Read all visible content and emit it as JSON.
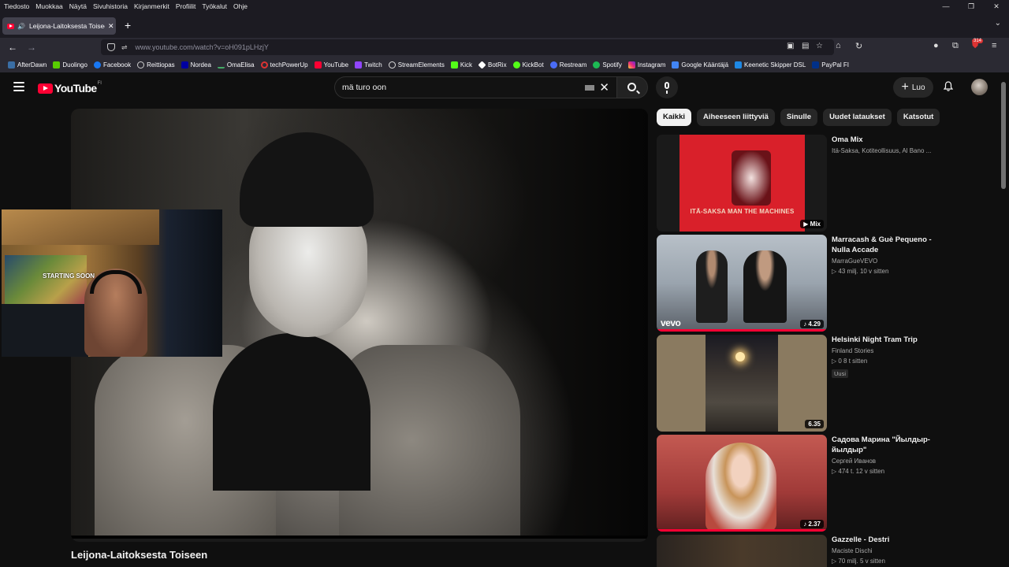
{
  "menubar": {
    "items": [
      "Tiedosto",
      "Muokkaa",
      "Näytä",
      "Sivuhistoria",
      "Kirjanmerkit",
      "Profiilit",
      "Työkalut",
      "Ohje"
    ]
  },
  "window_controls": {
    "minimize": "—",
    "restore": "❐",
    "close": "✕"
  },
  "tab": {
    "title": "Leijona-Laitoksesta Toiseen",
    "close": "✕"
  },
  "new_tab": "+",
  "tab_overflow": "⌄",
  "urlbar": {
    "url": "www.youtube.com/watch?v=oH091pLHzjY"
  },
  "extensions_badge": "314",
  "bookmarks": [
    {
      "label": "AfterDawn",
      "color": "#3a6ea5"
    },
    {
      "label": "Duolingo",
      "color": "#58cc02"
    },
    {
      "label": "Facebook",
      "color": "#1877f2"
    },
    {
      "label": "Reittiopas",
      "color": "#cccccc"
    },
    {
      "label": "Nordea",
      "color": "#0000a0"
    },
    {
      "label": "OmaElisa",
      "color": "#2b2a33"
    },
    {
      "label": "techPowerUp",
      "color": "#d33"
    },
    {
      "label": "YouTube",
      "color": "#ff0033"
    },
    {
      "label": "Twitch",
      "color": "#9146ff"
    },
    {
      "label": "StreamElements",
      "color": "#dddddd"
    },
    {
      "label": "Kick",
      "color": "#53fc18"
    },
    {
      "label": "BotRix",
      "color": "#ffffff"
    },
    {
      "label": "KickBot",
      "color": "#53fc18"
    },
    {
      "label": "Restream",
      "color": "#4a6cf7"
    },
    {
      "label": "Spotify",
      "color": "#1db954"
    },
    {
      "label": "Instagram",
      "color": "#d6249f"
    },
    {
      "label": "Google Kääntäjä",
      "color": "#4285f4"
    },
    {
      "label": "Keenetic Skipper DSL",
      "color": "#1e88e5"
    },
    {
      "label": "PayPal FI",
      "color": "#003087"
    }
  ],
  "youtube": {
    "logo_text": "YouTube",
    "region": "FI",
    "search_query": "mä turo oon",
    "clear_label": "✕",
    "create_label": "Luo",
    "create_plus": "+"
  },
  "webcam": {
    "poster_text": "STARTING SOON"
  },
  "video": {
    "title": "Leijona-Laitoksesta Toiseen"
  },
  "chips": [
    "Kaikki",
    "Aiheeseen liittyviä",
    "Sinulle",
    "Uudet lataukset",
    "Katsotut"
  ],
  "recommendations": [
    {
      "title": "Oma Mix",
      "channel": "Itä-Saksa, Kotiteollisuus, Al Bano ...",
      "stats": "",
      "duration": "▶ Mix",
      "thumb_text": "ITÄ-SAKSA  MAN THE MACHINES"
    },
    {
      "title": "Marracash & Guè Pequeno - Nulla Accade",
      "channel": "MarraGueVEVO",
      "stats": "▷ 43 milj.   10 v sitten",
      "duration": "♪ 4.29",
      "thumb_text": "vevo"
    },
    {
      "title": "Helsinki Night Tram Trip",
      "channel": "Finland Stories",
      "stats": "▷ 0   8 t sitten",
      "badge": "Uusi",
      "duration": "6.35"
    },
    {
      "title": "Садова Марина \"Йылдыр-йылдыр\"",
      "channel": "Сергей Иванов",
      "stats": "▷ 474 t.   12 v sitten",
      "duration": "♪ 2.37"
    },
    {
      "title": "Gazzelle - Destri",
      "channel": "Maciste Dischi",
      "stats": "▷ 70 milj.   5 v sitten",
      "duration": ""
    }
  ]
}
